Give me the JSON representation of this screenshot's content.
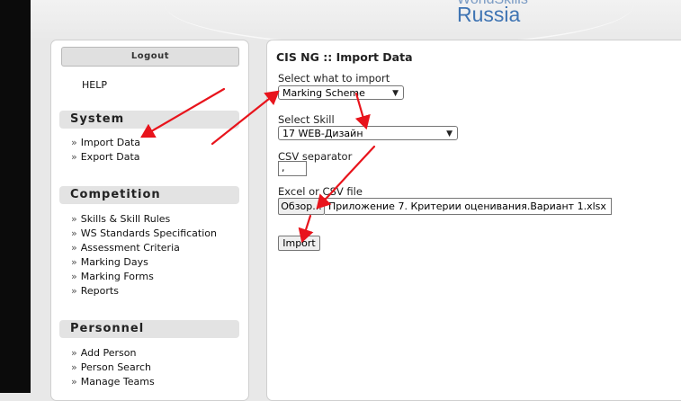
{
  "header": {
    "brand_partial": "WorldSkills",
    "brand": "Russia"
  },
  "sidebar": {
    "logout_label": "Logout",
    "help_label": "HELP",
    "sections": [
      {
        "title": "System",
        "items": [
          "Import Data",
          "Export Data"
        ]
      },
      {
        "title": "Competition",
        "items": [
          "Skills & Skill Rules",
          "WS Standards Specification",
          "Assessment Criteria",
          "Marking Days",
          "Marking Forms",
          "Reports"
        ]
      },
      {
        "title": "Personnel",
        "items": [
          "Add Person",
          "Person Search",
          "Manage Teams"
        ]
      }
    ],
    "bullet": "»"
  },
  "main": {
    "title": "CIS NG :: Import Data",
    "import_what_label": "Select what to import",
    "import_what_value": "Marking Scheme",
    "skill_label": "Select Skill",
    "skill_value": "17 WEB-Дизайн",
    "csv_label": "CSV separator",
    "csv_value": ",",
    "file_label": "Excel or CSV file",
    "browse_label": "Обзор...",
    "file_name": "Приложение 7. Критерии оценивания.Вариант 1.xlsx",
    "import_button": "Import"
  },
  "annotations": {
    "arrow_color": "#e8141c"
  }
}
